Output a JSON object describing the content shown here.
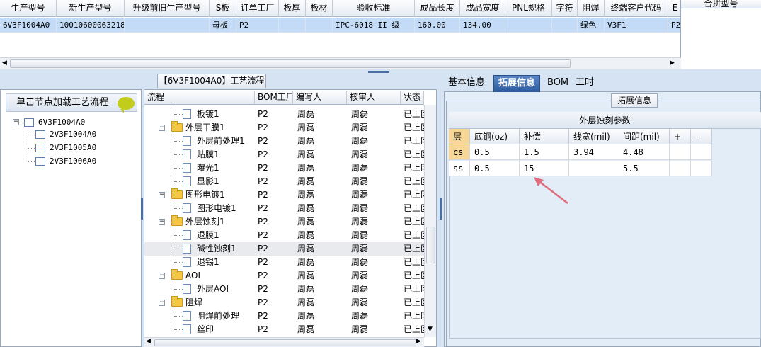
{
  "top_grid": {
    "columns": [
      "生产型号",
      "新生产型号",
      "升级前旧生产型号",
      "S板",
      "订单工厂",
      "板厚",
      "板材",
      "验收标准",
      "成品长度",
      "成品宽度",
      "PNL规格",
      "字符",
      "阻焊",
      "终端客户代码",
      "E"
    ],
    "row": [
      "6V3F1004A0",
      "10010600063218",
      "",
      "母板",
      "P2",
      "",
      "",
      "IPC-6018 II 级",
      "160.00",
      "134.00",
      "",
      "",
      "绿色",
      "V3F1",
      "P2"
    ],
    "right_header": "合拼型号"
  },
  "left_panel": {
    "load_label": "单击节点加载工艺流程",
    "root": "6V3F1004A0",
    "children": [
      "2V3F1004A0",
      "2V3F1005A0",
      "2V3F1006A0"
    ]
  },
  "center": {
    "tab_title": "【6V3F1004A0】工艺流程",
    "headers": [
      "流程",
      "BOM工厂",
      "编写人",
      "核审人",
      "状态"
    ],
    "rows": [
      {
        "name": "板镀1",
        "level": 2,
        "type": "doc",
        "factory": "P2",
        "writer": "周磊",
        "reviewer": "周磊",
        "status": "已上区"
      },
      {
        "name": "外层干膜1",
        "level": 1,
        "type": "folder",
        "factory": "P2",
        "writer": "周磊",
        "reviewer": "周磊",
        "status": "已上区"
      },
      {
        "name": "外层前处理1",
        "level": 2,
        "type": "doc",
        "factory": "P2",
        "writer": "周磊",
        "reviewer": "周磊",
        "status": "已上区"
      },
      {
        "name": "贴膜1",
        "level": 2,
        "type": "doc",
        "factory": "P2",
        "writer": "周磊",
        "reviewer": "周磊",
        "status": "已上区"
      },
      {
        "name": "曝光1",
        "level": 2,
        "type": "doc",
        "factory": "P2",
        "writer": "周磊",
        "reviewer": "周磊",
        "status": "已上区"
      },
      {
        "name": "显影1",
        "level": 2,
        "type": "doc",
        "factory": "P2",
        "writer": "周磊",
        "reviewer": "周磊",
        "status": "已上区"
      },
      {
        "name": "图形电镀1",
        "level": 1,
        "type": "folder",
        "factory": "P2",
        "writer": "周磊",
        "reviewer": "周磊",
        "status": "已上区"
      },
      {
        "name": "图形电镀1",
        "level": 2,
        "type": "doc",
        "factory": "P2",
        "writer": "周磊",
        "reviewer": "周磊",
        "status": "已上区"
      },
      {
        "name": "外层蚀刻1",
        "level": 1,
        "type": "folder",
        "factory": "P2",
        "writer": "周磊",
        "reviewer": "周磊",
        "status": "已上区"
      },
      {
        "name": "退膜1",
        "level": 2,
        "type": "doc",
        "factory": "P2",
        "writer": "周磊",
        "reviewer": "周磊",
        "status": "已上区"
      },
      {
        "name": "碱性蚀刻1",
        "level": 2,
        "type": "doc",
        "factory": "P2",
        "writer": "周磊",
        "reviewer": "周磊",
        "status": "已上区",
        "selected": true
      },
      {
        "name": "退锡1",
        "level": 2,
        "type": "doc",
        "factory": "P2",
        "writer": "周磊",
        "reviewer": "周磊",
        "status": "已上区"
      },
      {
        "name": "AOI",
        "level": 1,
        "type": "folder",
        "factory": "P2",
        "writer": "周磊",
        "reviewer": "周磊",
        "status": "已上区"
      },
      {
        "name": "外层AOI",
        "level": 2,
        "type": "doc",
        "factory": "P2",
        "writer": "周磊",
        "reviewer": "周磊",
        "status": "已上区"
      },
      {
        "name": "阻焊",
        "level": 1,
        "type": "folder",
        "factory": "P2",
        "writer": "周磊",
        "reviewer": "周磊",
        "status": "已上区"
      },
      {
        "name": "阻焊前处理",
        "level": 2,
        "type": "doc",
        "factory": "P2",
        "writer": "周磊",
        "reviewer": "周磊",
        "status": "已上区"
      },
      {
        "name": "丝印",
        "level": 2,
        "type": "doc",
        "factory": "P2",
        "writer": "周磊",
        "reviewer": "周磊",
        "status": "已上区"
      }
    ]
  },
  "right": {
    "tabs": [
      "基本信息",
      "拓展信息",
      "BOM",
      "工时"
    ],
    "active_tab": "拓展信息",
    "group_title": "拓展信息",
    "etch_title": "外层蚀刻参数",
    "etch_headers": [
      "层",
      "底铜(oz)",
      "补偿",
      "线宽(mil)",
      "间距(mil)",
      "+",
      "-"
    ],
    "etch_rows": [
      [
        "cs",
        "0.5",
        "1.5",
        "3.94",
        "4.48",
        "",
        ""
      ],
      [
        "ss",
        "0.5",
        "15",
        "",
        "5.5",
        "",
        ""
      ]
    ],
    "accent_color": "#e06d7d"
  }
}
